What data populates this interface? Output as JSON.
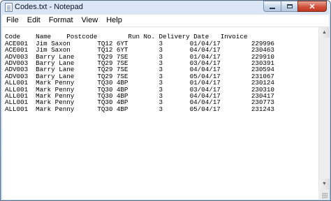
{
  "window": {
    "title": "Codes.txt - Notepad"
  },
  "menu": [
    "File",
    "Edit",
    "Format",
    "View",
    "Help"
  ],
  "editor": {
    "lines": [
      "Code    Name    Postcode        Run No. Delivery Date   Invoice",
      "ACE001  Jim Saxon       TQ12 6YT        3       01/04/17        229996",
      "ACE001  Jim Saxon       TQ12 6YT        3       04/04/17        230463",
      "ADV003  Barry Lane      TQ29 7SE        3       01/04/17        229910",
      "ADV003  Barry Lane      TQ29 7SE        3       03/04/17        230391",
      "ADV003  Barry Lane      TQ29 7SE        3       04/04/17        230594",
      "ADV003  Barry Lane      TQ29 7SE        3       05/04/17        231067",
      "ALL001  Mark Penny      TQ30 4BP        3       01/04/17        230124",
      "ALL001  Mark Penny      TQ30 4BP        3       03/04/17        230310",
      "ALL001  Mark Penny      TQ30 4BP        3       04/04/17        230417",
      "ALL001  Mark Penny      TQ30 4BP        3       04/04/17        230773",
      "ALL001  Mark Penny      TQ30 4BP        3       05/04/17        231243"
    ]
  },
  "icons": {
    "app": "notepad-icon",
    "minimize": "minimize-icon",
    "maximize": "maximize-icon",
    "close": "close-icon",
    "scroll_up": "arrow-up-icon",
    "scroll_down": "arrow-down-icon"
  },
  "colors": {
    "titlebar": "#c4d6ec",
    "close_button": "#c2361f"
  }
}
